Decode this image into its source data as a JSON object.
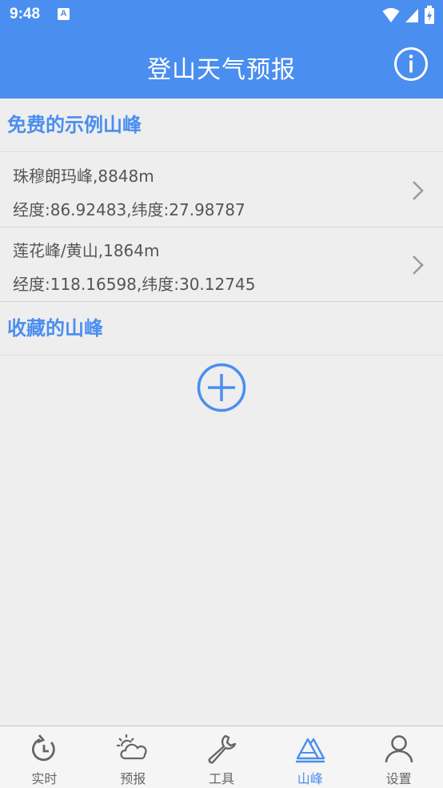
{
  "status": {
    "time": "9:48",
    "notification_letter": "A"
  },
  "header": {
    "title": "登山天气预报"
  },
  "sections": {
    "free": "免费的示例山峰",
    "favorites": "收藏的山峰"
  },
  "mountains": [
    {
      "name": "珠穆朗玛峰,8848m",
      "coords": "经度:86.92483,纬度:27.98787"
    },
    {
      "name": "莲花峰/黄山,1864m",
      "coords": "经度:118.16598,纬度:30.12745"
    }
  ],
  "tabs": [
    {
      "label": "实时",
      "icon": "realtime-icon"
    },
    {
      "label": "预报",
      "icon": "forecast-icon"
    },
    {
      "label": "工具",
      "icon": "wrench-icon"
    },
    {
      "label": "山峰",
      "icon": "mountain-icon",
      "active": true
    },
    {
      "label": "设置",
      "icon": "person-icon"
    }
  ],
  "colors": {
    "primary": "#4a8ef0",
    "background": "#eeeeee",
    "text": "#555555"
  }
}
